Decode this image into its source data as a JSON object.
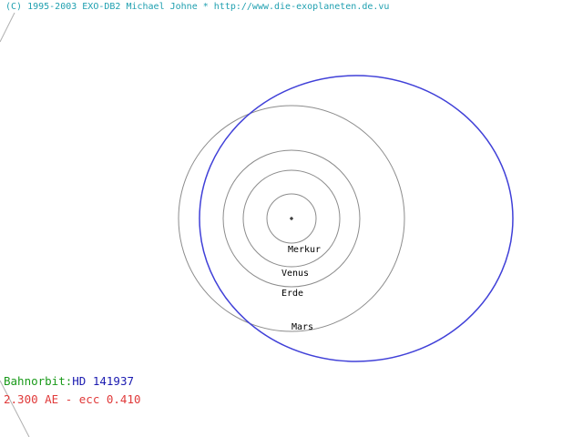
{
  "header": {
    "copyright": "(C) 1995-2003 EXO-DB2 Michael Johne * http://www.die-exoplaneten.de.vu"
  },
  "orbits": {
    "planets": [
      {
        "name": "Merkur"
      },
      {
        "name": "Venus"
      },
      {
        "name": "Erde"
      },
      {
        "name": "Mars"
      }
    ],
    "exoplanet": {
      "semi_major_axis_au": 2.3,
      "eccentricity": 0.41
    }
  },
  "info": {
    "label": "Bahnorbit:",
    "star_name": "HD 141937",
    "details": "2.300 AE - ecc 0.410"
  },
  "colors": {
    "text_cyan": "#20a0b0",
    "label_green": "#1a9a1a",
    "star_blue": "#1a1ab0",
    "details_red": "#e03a3a",
    "orbit_gray": "#8c8c8c",
    "exo_orbit_blue": "#4040d8"
  }
}
